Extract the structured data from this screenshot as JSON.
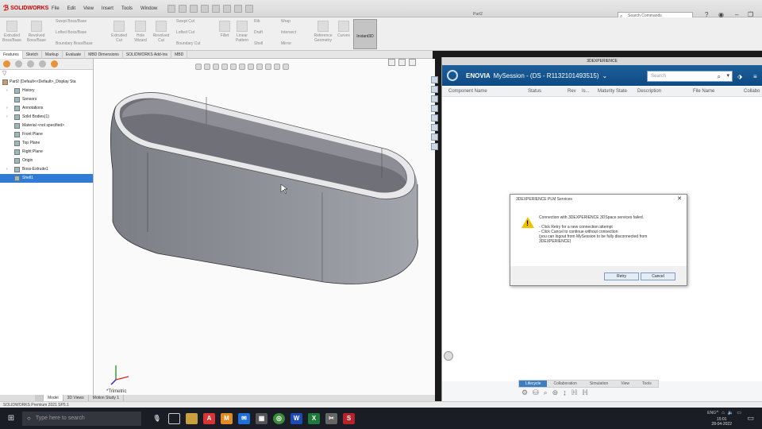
{
  "app": {
    "name": "SOLIDWORKS",
    "doc_title": "Part2"
  },
  "menu": [
    "File",
    "Edit",
    "View",
    "Insert",
    "Tools",
    "Window"
  ],
  "search_commands": {
    "placeholder": "Search Commands"
  },
  "command_manager": {
    "buttons": [
      {
        "label": "Extruded Boss/Base"
      },
      {
        "label": "Revolved Boss/Base"
      },
      {
        "label": "Swept Boss/Base"
      },
      {
        "label": "Lofted Boss/Base"
      },
      {
        "label": "Boundary Boss/Base"
      },
      {
        "label": "Extruded Cut"
      },
      {
        "label": "Hole Wizard"
      },
      {
        "label": "Revolved Cut"
      },
      {
        "label": "Swept Cut"
      },
      {
        "label": "Lofted Cut"
      },
      {
        "label": "Boundary Cut"
      },
      {
        "label": "Fillet"
      },
      {
        "label": "Linear Pattern"
      },
      {
        "label": "Rib"
      },
      {
        "label": "Draft"
      },
      {
        "label": "Shell"
      },
      {
        "label": "Wrap"
      },
      {
        "label": "Intersect"
      },
      {
        "label": "Mirror"
      },
      {
        "label": "Reference Geometry"
      },
      {
        "label": "Curves"
      }
    ],
    "active_button": "Instant3D"
  },
  "cm_tabs": [
    "Features",
    "Sketch",
    "Markup",
    "Evaluate",
    "MBD Dimensions",
    "SOLIDWORKS Add-Ins",
    "MBD"
  ],
  "feature_tree": {
    "root": "Part2 (Default<<Default>_Display Sta",
    "items": [
      {
        "label": "History"
      },
      {
        "label": "Sensors"
      },
      {
        "label": "Annotations"
      },
      {
        "label": "Solid Bodies(1)"
      },
      {
        "label": "Material <not specified>"
      },
      {
        "label": "Front Plane"
      },
      {
        "label": "Top Plane"
      },
      {
        "label": "Right Plane"
      },
      {
        "label": "Origin"
      },
      {
        "label": "Boss-Extrude1"
      },
      {
        "label": "Shell1"
      }
    ]
  },
  "viewport": {
    "view_label": "*Trimetric"
  },
  "model_tabs": [
    "Model",
    "3D Views",
    "Motion Study 1"
  ],
  "statusbar": {
    "text": "SOLIDWORKS Premium 2021 SP5.1"
  },
  "dx_panel": {
    "title": "3DEXPERIENCE",
    "brand": "ENOVIA",
    "session": "MySession - (DS - R1132101493515)",
    "search_placeholder": "Search",
    "columns": [
      "Component Name",
      "Status",
      "Rev",
      "Is...",
      "Maturity State",
      "Description",
      "File Name",
      "Collabo"
    ],
    "bottom_tabs": [
      "Lifecycle",
      "Collaboration",
      "Simulation",
      "View",
      "Tools"
    ],
    "active_bottom_tab": "Lifecycle"
  },
  "dialog": {
    "title": "3DEXPERIENCE PLM Services",
    "message": "Connection with 3DEXPERIENCE 3DSpace services failed.",
    "lines": [
      "- Click Retry for a new connection attempt",
      "- Click Cancel to continue without connection",
      "(you can logout from MySession to be fully disconnected from",
      "3DEXPERIENCE)"
    ],
    "retry_label": "Retry",
    "cancel_label": "Cancel"
  },
  "taskbar": {
    "search_placeholder": "Type here to search",
    "lang": "ENG",
    "time": "15:01",
    "date": "28-04-2022"
  },
  "colors": {
    "enovia_header": "#0e4a83",
    "selection_blue": "#2f7bd6",
    "warning_yellow": "#f2c200",
    "model_fill": "#9a9ca4",
    "taskbar": "#1b1d26"
  }
}
